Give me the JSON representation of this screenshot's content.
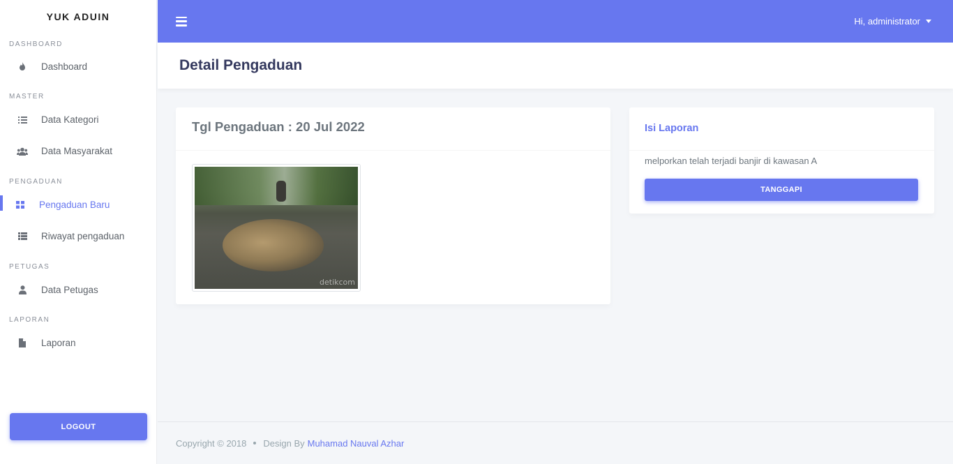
{
  "sidebar": {
    "brand": "YUK ADUIN",
    "sections": [
      {
        "header": "DASHBOARD",
        "items": [
          {
            "label": "Dashboard",
            "icon": "fire-icon"
          }
        ]
      },
      {
        "header": "MASTER",
        "items": [
          {
            "label": "Data Kategori",
            "icon": "list-icon"
          },
          {
            "label": "Data Masyarakat",
            "icon": "users-icon"
          }
        ]
      },
      {
        "header": "PENGADUAN",
        "items": [
          {
            "label": "Pengaduan Baru",
            "icon": "grid-icon",
            "active": true
          },
          {
            "label": "Riwayat pengaduan",
            "icon": "table-icon"
          }
        ]
      },
      {
        "header": "PETUGAS",
        "items": [
          {
            "label": "Data Petugas",
            "icon": "user-icon"
          }
        ]
      },
      {
        "header": "LAPORAN",
        "items": [
          {
            "label": "Laporan",
            "icon": "file-icon"
          }
        ]
      }
    ],
    "logout_label": "LOGOUT"
  },
  "navbar": {
    "user_greeting": "Hi, administrator"
  },
  "page": {
    "title": "Detail Pengaduan"
  },
  "complaint": {
    "date_heading": "Tgl Pengaduan : 20 Jul 2022",
    "photo_watermark": "detikcom"
  },
  "report": {
    "heading": "Isi Laporan",
    "text": "melporkan telah terjadi banjir di kawasan A",
    "respond_label": "TANGGAPI"
  },
  "footer": {
    "copyright": "Copyright © 2018",
    "design_by": "Design By",
    "author": "Muhamad Nauval Azhar"
  },
  "colors": {
    "primary": "#6777ef",
    "background": "#f4f6f9",
    "title": "#34395e"
  }
}
